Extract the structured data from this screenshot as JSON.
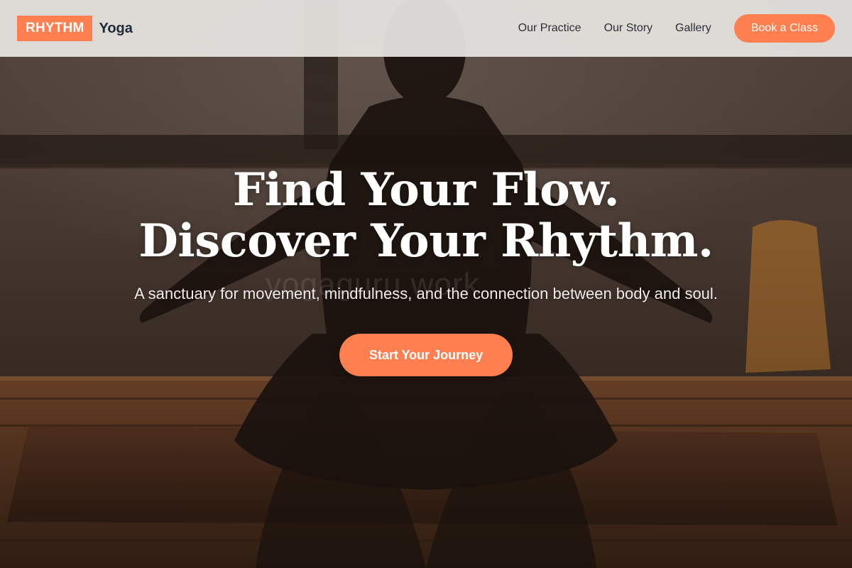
{
  "nav": {
    "brand_box": "RHYTHM",
    "brand_word": "Yoga",
    "links": [
      "Our Practice",
      "Our Story",
      "Gallery"
    ],
    "cta": "Book a Class"
  },
  "hero": {
    "headline_line1": "Find Your Flow.",
    "headline_line2": "Discover Your Rhythm.",
    "tagline": "A sanctuary for movement, mindfulness, and the connection between body and soul.",
    "cta": "Start Your Journey",
    "watermark": "yogaguru.work"
  },
  "colors": {
    "accent": "#ff7f50",
    "nav_bg": "#e8e5e2",
    "nav_text": "#2b2f36",
    "hero_text": "#ffffff"
  }
}
